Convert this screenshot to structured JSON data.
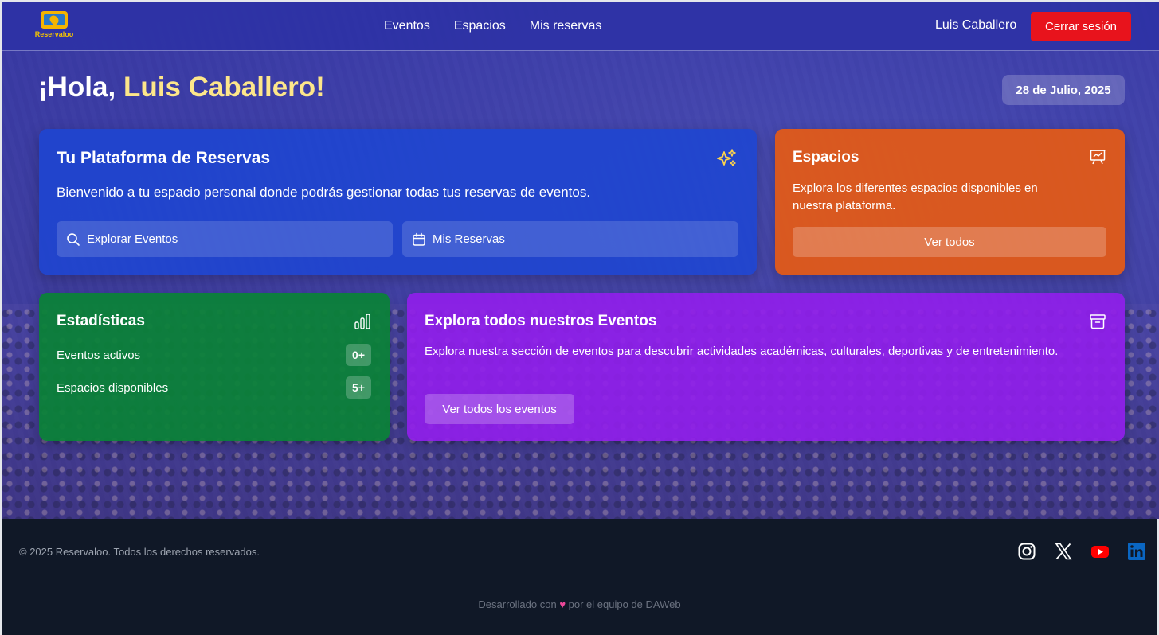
{
  "brand": {
    "logo_text": "Reservaloo"
  },
  "nav": {
    "links": [
      "Eventos",
      "Espacios",
      "Mis reservas"
    ],
    "user_name": "Luis Caballero",
    "logout_label": "Cerrar sesión"
  },
  "greeting": {
    "prefix": "¡Hola,",
    "first_name": "Luis",
    "last_name": "Caballero!"
  },
  "date": "28 de Julio, 2025",
  "platform_card": {
    "title": "Tu Plataforma de Reservas",
    "description": "Bienvenido a tu espacio personal donde podrás gestionar todas tus reservas de eventos.",
    "explore_label": "Explorar Eventos",
    "bookings_label": "Mis Reservas",
    "icon": "sparkles-icon"
  },
  "spaces_card": {
    "title": "Espacios",
    "description": "Explora los diferentes espacios disponibles en nuestra plataforma.",
    "button_label": "Ver todos",
    "icon": "presentation-icon"
  },
  "stats_card": {
    "title": "Estadísticas",
    "rows": [
      {
        "label": "Eventos activos",
        "value": "0+"
      },
      {
        "label": "Espacios disponibles",
        "value": "5+"
      }
    ],
    "icon": "bar-chart-icon"
  },
  "events_card": {
    "title": "Explora todos nuestros Eventos",
    "description": "Explora nuestra sección de eventos para descubrir actividades académicas, culturales, deportivas y de entretenimiento.",
    "button_label": "Ver todos los eventos",
    "icon": "archive-icon"
  },
  "footer": {
    "copyright": "© 2025 Reservaloo. Todos los derechos reservados.",
    "credit_prefix": "Desarrollado con",
    "credit_suffix": "por el equipo de DAWeb",
    "socials": [
      "instagram-icon",
      "x-icon",
      "youtube-icon",
      "linkedin-icon"
    ]
  },
  "colors": {
    "logout": "#e8131c",
    "platform": "#1e46d2",
    "spaces": "#e65a14",
    "stats": "#0a8237",
    "events": "#911eeb",
    "footer": "#101827",
    "greeting_accent": "#fde68a"
  }
}
